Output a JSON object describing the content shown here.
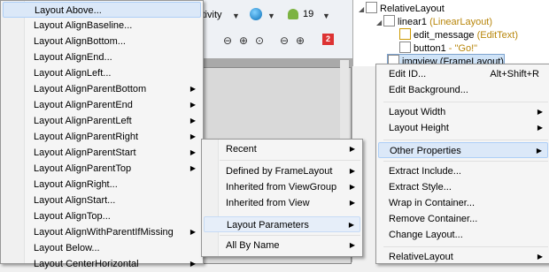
{
  "toolbar": {
    "activity_text": "ctivity",
    "api_level": "19",
    "error_count": "2"
  },
  "outline": {
    "items": [
      {
        "name": "RelativeLayout",
        "sub": ""
      },
      {
        "name": "linear1",
        "sub": "(LinearLayout)"
      },
      {
        "name": "edit_message",
        "sub": "(EditText)"
      },
      {
        "name": "button1",
        "sub": "- \"Go!\""
      },
      {
        "name": "imgview",
        "sub": "(FrameLayout)"
      }
    ]
  },
  "layout_menu": {
    "items": [
      {
        "label": "Layout Above..."
      },
      {
        "label": "Layout AlignBaseline..."
      },
      {
        "label": "Layout AlignBottom..."
      },
      {
        "label": "Layout AlignEnd..."
      },
      {
        "label": "Layout AlignLeft..."
      },
      {
        "label": "Layout AlignParentBottom"
      },
      {
        "label": "Layout AlignParentEnd"
      },
      {
        "label": "Layout AlignParentLeft"
      },
      {
        "label": "Layout AlignParentRight"
      },
      {
        "label": "Layout AlignParentStart"
      },
      {
        "label": "Layout AlignParentTop"
      },
      {
        "label": "Layout AlignRight..."
      },
      {
        "label": "Layout AlignStart..."
      },
      {
        "label": "Layout AlignTop..."
      },
      {
        "label": "Layout AlignWithParentIfMissing"
      },
      {
        "label": "Layout Below..."
      },
      {
        "label": "Layout CenterHorizontal"
      }
    ]
  },
  "props_menu": {
    "items": [
      {
        "label": "Recent"
      },
      {
        "label": "Defined by FrameLayout"
      },
      {
        "label": "Inherited from ViewGroup"
      },
      {
        "label": "Inherited from View"
      },
      {
        "label": "Layout Parameters"
      },
      {
        "label": "All By Name"
      }
    ]
  },
  "context_menu": {
    "items": [
      {
        "label": "Edit ID...",
        "shortcut": "Alt+Shift+R"
      },
      {
        "label": "Edit Background..."
      },
      {
        "label": "Layout Width"
      },
      {
        "label": "Layout Height"
      },
      {
        "label": "Other Properties"
      },
      {
        "label": "Extract Include..."
      },
      {
        "label": "Extract Style..."
      },
      {
        "label": "Wrap in Container..."
      },
      {
        "label": "Remove Container..."
      },
      {
        "label": "Change Layout..."
      },
      {
        "label": "RelativeLayout"
      }
    ]
  },
  "colors": {
    "highlight": "#dbe8f8",
    "highlight_border": "#aecff7",
    "subtitle": "#b8860b",
    "error": "#dd3333"
  }
}
